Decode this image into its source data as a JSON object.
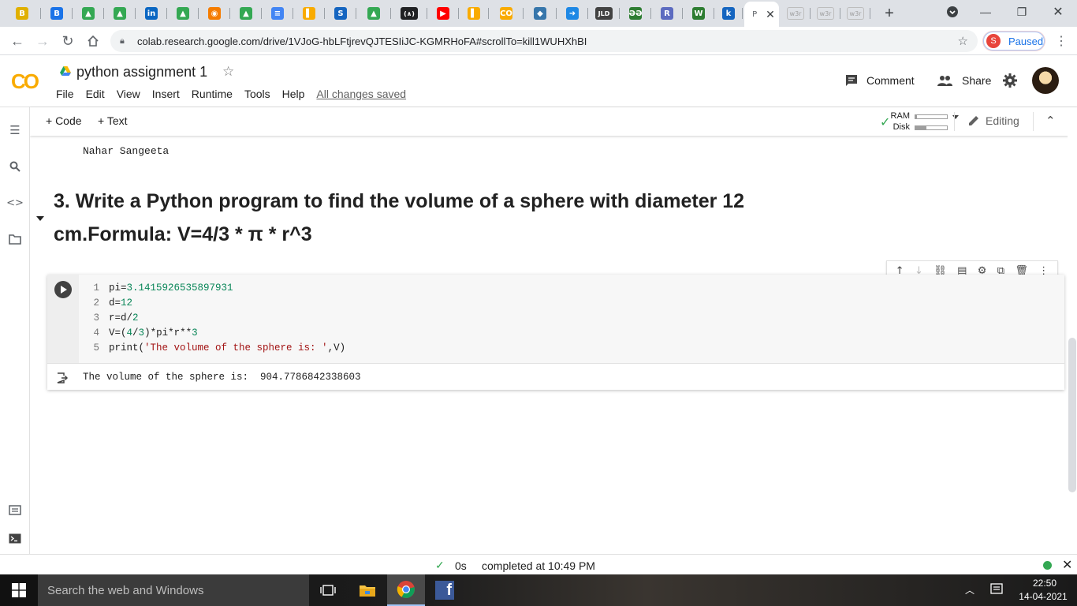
{
  "browser": {
    "tab_favicons": [
      {
        "label": "B",
        "color": "#e0b000"
      },
      {
        "label": "B",
        "color": "#1a73e8"
      },
      {
        "label": "▲",
        "color": "#34a853"
      },
      {
        "label": "▲",
        "color": "#34a853"
      },
      {
        "label": "in",
        "color": "#0a66c2"
      },
      {
        "label": "▲",
        "color": "#34a853"
      },
      {
        "label": "◉",
        "color": "#f57c00"
      },
      {
        "label": "▲",
        "color": "#34a853"
      },
      {
        "label": "≡",
        "color": "#4285f4"
      },
      {
        "label": "▌",
        "color": "#f9ab00"
      },
      {
        "label": "S",
        "color": "#1565c0"
      },
      {
        "label": "▲",
        "color": "#34a853"
      },
      {
        "label": "(∧)",
        "color": "#202124"
      },
      {
        "label": "▶",
        "color": "#ff0000"
      },
      {
        "label": "▌",
        "color": "#f9ab00"
      },
      {
        "label": "CO",
        "color": "#f9ab00"
      },
      {
        "label": "◆",
        "color": "#3776ab"
      },
      {
        "label": "➜",
        "color": "#1e88e5"
      },
      {
        "label": "JLD",
        "color": "#424242"
      },
      {
        "label": "ƏƏ",
        "color": "#2e7d32"
      },
      {
        "label": "R",
        "color": "#5c6bc0"
      },
      {
        "label": "W",
        "color": "#2e7d32"
      },
      {
        "label": "k",
        "color": "#1565c0"
      }
    ],
    "active_tab_icon": "P",
    "w3_tabs": [
      "w3r",
      "w3r",
      "w3r"
    ],
    "new_tab": "+",
    "url": "colab.research.google.com/drive/1VJoG-hbLFtjrevQJTESIiJC-KGMRHoFA#scrollTo=kill1WUHXhBI",
    "profile_initial": "S",
    "profile_status": "Paused"
  },
  "colab": {
    "logo": "CO",
    "title": "python assignment 1",
    "menu": [
      "File",
      "Edit",
      "View",
      "Insert",
      "Runtime",
      "Tools",
      "Help"
    ],
    "save_status": "All changes saved",
    "comment_label": "Comment",
    "share_label": "Share",
    "add_code": "+ Code",
    "add_text": "+ Text",
    "ram_label": "RAM",
    "disk_label": "Disk",
    "ram_usage": 0.05,
    "disk_usage": 0.35,
    "editing_label": "Editing"
  },
  "notebook": {
    "previous_output": "Nahar Sangeeta",
    "heading_line1": "3. Write a Python program to find the volume of a sphere with diameter 12",
    "heading_line2": "cm.Formula: V=4/3 * π * r^3",
    "code_lines": [
      {
        "n": "1",
        "text": "pi=3.1415926535897931"
      },
      {
        "n": "2",
        "text": "d=12"
      },
      {
        "n": "3",
        "text": "r=d/2"
      },
      {
        "n": "4",
        "text": "V=(4/3)*pi*r**3"
      },
      {
        "n": "5",
        "text": "print('The volume of the sphere is: ',V)"
      }
    ],
    "output": "The volume of the sphere is:  904.7786842338603"
  },
  "status": {
    "duration": "0s",
    "completed": "completed at 10:49 PM"
  },
  "taskbar": {
    "search_placeholder": "Search the web and Windows",
    "time": "22:50",
    "date": "14-04-2021"
  }
}
